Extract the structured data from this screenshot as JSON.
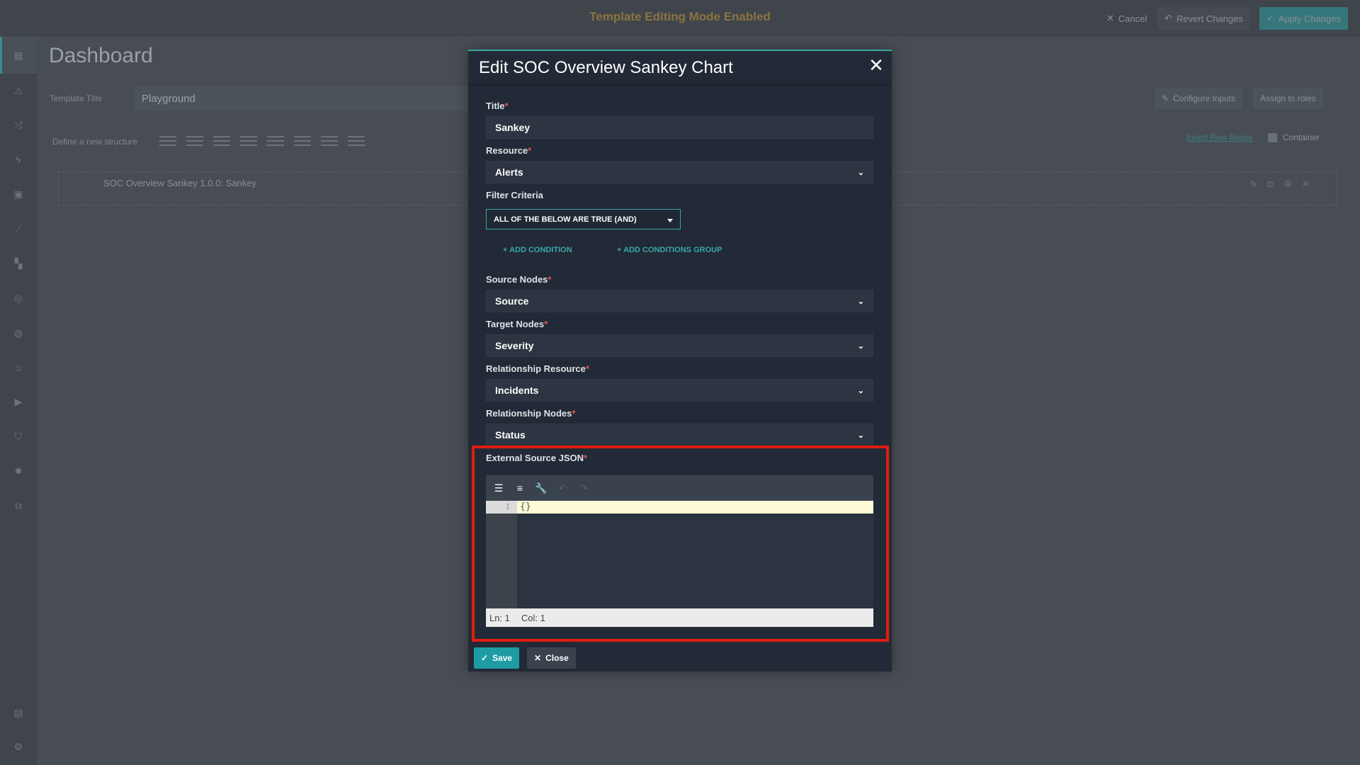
{
  "topbar": {
    "mode_text": "Template Editing Mode Enabled",
    "cancel": "Cancel",
    "revert": "Revert Changes",
    "apply": "Apply Changes"
  },
  "page": {
    "title": "Dashboard",
    "template_title_label": "Template Title",
    "template_title_value": "Playground",
    "structure_label": "Define a new structure",
    "row_title": "SOC Overview Sankey 1.0.0: Sankey",
    "configure_inputs": "Configure Inputs",
    "assign_roles": "Assign to roles",
    "insert_row": "Insert Row Above",
    "container": "Container"
  },
  "modal": {
    "title": "Edit SOC Overview Sankey Chart",
    "close_symbol": "✕",
    "fields": {
      "title_label": "Title",
      "title_value": "Sankey",
      "resource_label": "Resource",
      "resource_value": "Alerts",
      "filter_label": "Filter Criteria",
      "filter_value": "ALL OF THE BELOW ARE TRUE (AND)",
      "add_condition": "+ ADD CONDITION",
      "add_group": "+ ADD CONDITIONS GROUP",
      "source_label": "Source Nodes",
      "source_value": "Source",
      "target_label": "Target Nodes",
      "target_value": "Severity",
      "rel_resource_label": "Relationship Resource",
      "rel_resource_value": "Incidents",
      "rel_nodes_label": "Relationship Nodes",
      "rel_nodes_value": "Status",
      "json_label": "External Source JSON"
    },
    "editor": {
      "line_number": "1",
      "code": "{}",
      "status_ln": "Ln: 1",
      "status_col": "Col: 1"
    },
    "buttons": {
      "save": "Save",
      "close": "Close"
    }
  },
  "colors": {
    "accent": "#3aa6a9",
    "highlight": "#e01d0e",
    "required": "#e25050"
  }
}
